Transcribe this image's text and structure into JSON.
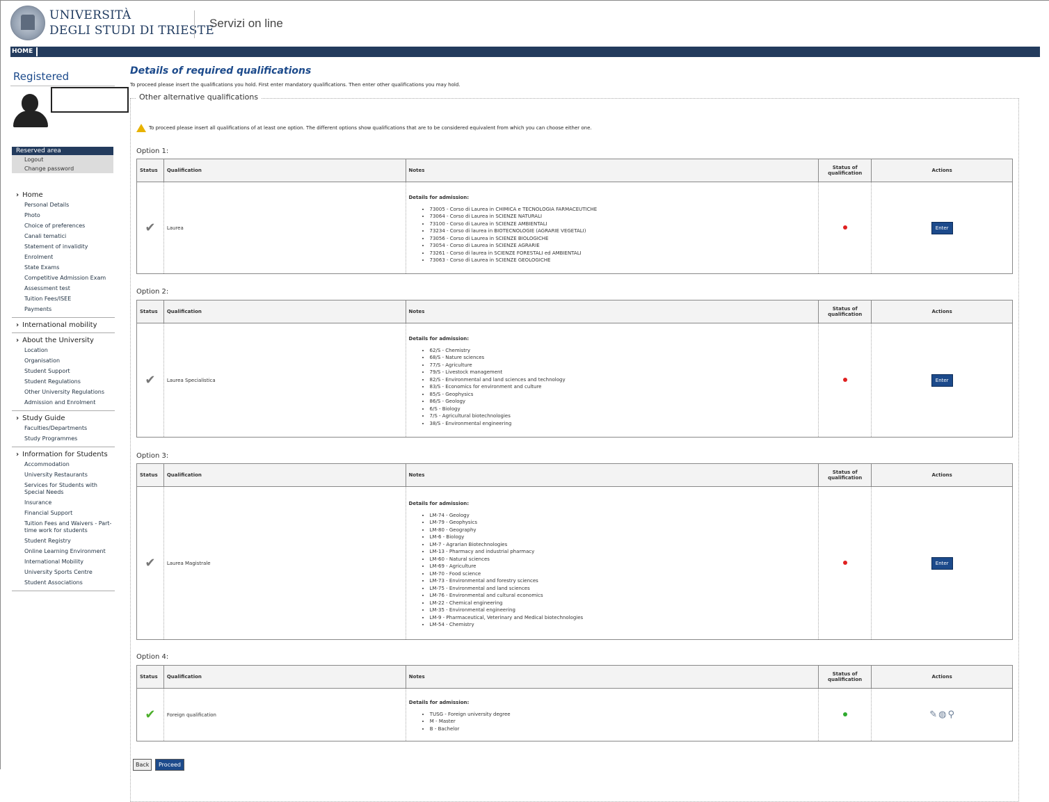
{
  "header": {
    "university_line1": "UNIVERSITÀ",
    "university_line2": "DEGLI STUDI DI TRIESTE",
    "services": "Servizi on line",
    "nav_home": "HOME"
  },
  "sidebar": {
    "registered": "Registered",
    "reserved_area": {
      "title": "Reserved area",
      "items": [
        "Logout",
        "Change password"
      ]
    },
    "menu": [
      {
        "section": "Home",
        "items": [
          "Personal Details",
          "Photo",
          "Choice of preferences",
          "Canali tematici",
          "Statement of invalidity",
          "Enrolment",
          "State Exams",
          "Competitive Admission Exam",
          "Assessment test",
          "Tuition Fees/ISEE",
          "Payments"
        ]
      },
      {
        "section": "International mobility",
        "items": []
      },
      {
        "section": "About the University",
        "items": [
          "Location",
          "Organisation",
          "Student Support",
          "Student Regulations",
          "Other University Regulations",
          "Admission and Enrolment"
        ]
      },
      {
        "section": "Study Guide",
        "items": [
          "Faculties/Departments",
          "Study Programmes"
        ]
      },
      {
        "section": "Information for Students",
        "items": [
          "Accommodation",
          "University Restaurants",
          "Services for Students with Special Needs",
          "Insurance",
          "Financial Support",
          "Tuition Fees and Waivers - Part-time work for students",
          "Student Registry",
          "Online Learning Environment",
          "International Mobility",
          "University Sports Centre",
          "Student Associations"
        ]
      }
    ]
  },
  "main": {
    "title": "Details of required qualifications",
    "intro": "To proceed please insert the qualifications you hold. First enter mandatory qualifications. Then enter other qualifications you may hold.",
    "legend": "Other alternative qualifications",
    "warning": "To proceed please insert all qualifications of at least one option. The different options show qualifications that are to be considered equivalent from which you can choose either one.",
    "columns": {
      "status": "Status",
      "qualification": "Qualification",
      "notes": "Notes",
      "status_qual": "Status of qualification",
      "actions": "Actions"
    },
    "notes_heading": "Details for admission:",
    "enter_label": "Enter",
    "options": [
      {
        "label": "Option 1:",
        "qualification": "Laurea",
        "qual_status": "red",
        "action": "enter",
        "notes": [
          "73005 - Corso di Laurea in CHIMICA e TECNOLOGIA FARMACEUTICHE",
          "73064 - Corso di Laurea in SCIENZE NATURALI",
          "73100 - Corso di Laurea in SCIENZE AMBIENTALI",
          "73234 - Corso di laurea in BIOTECNOLOGIE (AGRARIE VEGETALI)",
          "73056 - Corso di Laurea in SCIENZE BIOLOGICHE",
          "73054 - Corso di Laurea in SCIENZE AGRARIE",
          "73261 - Corso di laurea in SCIENZE FORESTALI ed AMBIENTALI",
          "73063 - Corso di Laurea in SCIENZE GEOLOGICHE"
        ]
      },
      {
        "label": "Option 2:",
        "qualification": "Laurea Specialistica",
        "qual_status": "red",
        "action": "enter",
        "notes": [
          "62/S - Chemistry",
          "68/S - Nature sciences",
          "77/S - Agriculture",
          "79/S - Livestock management",
          "82/S - Environmental and land sciences and technology",
          "83/S - Economics for environment and culture",
          "85/S - Geophysics",
          "86/S - Geology",
          "6/S - Biology",
          "7/S - Agricultural biotechnologies",
          "38/S - Environmental engineering"
        ]
      },
      {
        "label": "Option 3:",
        "qualification": "Laurea Magistrale",
        "qual_status": "red",
        "action": "enter",
        "notes": [
          "LM-74 - Geology",
          "LM-79 - Geophysics",
          "LM-80 - Geography",
          "LM-6 - Biology",
          "LM-7 - Agrarian Biotechnologies",
          "LM-13 - Pharmacy and industrial pharmacy",
          "LM-60 - Natural sciences",
          "LM-69 - Agriculture",
          "LM-70 - Food science",
          "LM-73 - Environmental and forestry sciences",
          "LM-75 - Environmental and land sciences",
          "LM-76 - Environmental and cultural economics",
          "LM-22 - Chemical engineering",
          "LM-35 - Environmental engineering",
          "LM-9 - Pharmaceutical, Veterinary and Medical biotechnologies",
          "LM-54 - Chemistry"
        ]
      },
      {
        "label": "Option 4:",
        "qualification": "Foreign qualification",
        "qual_status": "green",
        "action": "icons",
        "notes": [
          "TUSG - Foreign university degree",
          "M - Master",
          "B - Bachelor"
        ]
      }
    ],
    "back_label": "Back",
    "proceed_label": "Proceed"
  }
}
